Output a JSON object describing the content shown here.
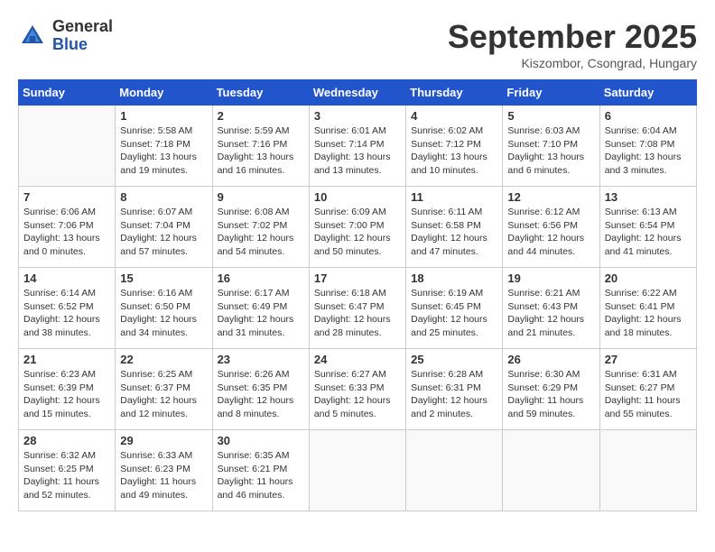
{
  "header": {
    "logo_general": "General",
    "logo_blue": "Blue",
    "month_title": "September 2025",
    "location": "Kiszombor, Csongrad, Hungary"
  },
  "days_of_week": [
    "Sunday",
    "Monday",
    "Tuesday",
    "Wednesday",
    "Thursday",
    "Friday",
    "Saturday"
  ],
  "weeks": [
    [
      {
        "day": "",
        "empty": true
      },
      {
        "day": "1",
        "sunrise": "Sunrise: 5:58 AM",
        "sunset": "Sunset: 7:18 PM",
        "daylight": "Daylight: 13 hours and 19 minutes."
      },
      {
        "day": "2",
        "sunrise": "Sunrise: 5:59 AM",
        "sunset": "Sunset: 7:16 PM",
        "daylight": "Daylight: 13 hours and 16 minutes."
      },
      {
        "day": "3",
        "sunrise": "Sunrise: 6:01 AM",
        "sunset": "Sunset: 7:14 PM",
        "daylight": "Daylight: 13 hours and 13 minutes."
      },
      {
        "day": "4",
        "sunrise": "Sunrise: 6:02 AM",
        "sunset": "Sunset: 7:12 PM",
        "daylight": "Daylight: 13 hours and 10 minutes."
      },
      {
        "day": "5",
        "sunrise": "Sunrise: 6:03 AM",
        "sunset": "Sunset: 7:10 PM",
        "daylight": "Daylight: 13 hours and 6 minutes."
      },
      {
        "day": "6",
        "sunrise": "Sunrise: 6:04 AM",
        "sunset": "Sunset: 7:08 PM",
        "daylight": "Daylight: 13 hours and 3 minutes."
      }
    ],
    [
      {
        "day": "7",
        "sunrise": "Sunrise: 6:06 AM",
        "sunset": "Sunset: 7:06 PM",
        "daylight": "Daylight: 13 hours and 0 minutes."
      },
      {
        "day": "8",
        "sunrise": "Sunrise: 6:07 AM",
        "sunset": "Sunset: 7:04 PM",
        "daylight": "Daylight: 12 hours and 57 minutes."
      },
      {
        "day": "9",
        "sunrise": "Sunrise: 6:08 AM",
        "sunset": "Sunset: 7:02 PM",
        "daylight": "Daylight: 12 hours and 54 minutes."
      },
      {
        "day": "10",
        "sunrise": "Sunrise: 6:09 AM",
        "sunset": "Sunset: 7:00 PM",
        "daylight": "Daylight: 12 hours and 50 minutes."
      },
      {
        "day": "11",
        "sunrise": "Sunrise: 6:11 AM",
        "sunset": "Sunset: 6:58 PM",
        "daylight": "Daylight: 12 hours and 47 minutes."
      },
      {
        "day": "12",
        "sunrise": "Sunrise: 6:12 AM",
        "sunset": "Sunset: 6:56 PM",
        "daylight": "Daylight: 12 hours and 44 minutes."
      },
      {
        "day": "13",
        "sunrise": "Sunrise: 6:13 AM",
        "sunset": "Sunset: 6:54 PM",
        "daylight": "Daylight: 12 hours and 41 minutes."
      }
    ],
    [
      {
        "day": "14",
        "sunrise": "Sunrise: 6:14 AM",
        "sunset": "Sunset: 6:52 PM",
        "daylight": "Daylight: 12 hours and 38 minutes."
      },
      {
        "day": "15",
        "sunrise": "Sunrise: 6:16 AM",
        "sunset": "Sunset: 6:50 PM",
        "daylight": "Daylight: 12 hours and 34 minutes."
      },
      {
        "day": "16",
        "sunrise": "Sunrise: 6:17 AM",
        "sunset": "Sunset: 6:49 PM",
        "daylight": "Daylight: 12 hours and 31 minutes."
      },
      {
        "day": "17",
        "sunrise": "Sunrise: 6:18 AM",
        "sunset": "Sunset: 6:47 PM",
        "daylight": "Daylight: 12 hours and 28 minutes."
      },
      {
        "day": "18",
        "sunrise": "Sunrise: 6:19 AM",
        "sunset": "Sunset: 6:45 PM",
        "daylight": "Daylight: 12 hours and 25 minutes."
      },
      {
        "day": "19",
        "sunrise": "Sunrise: 6:21 AM",
        "sunset": "Sunset: 6:43 PM",
        "daylight": "Daylight: 12 hours and 21 minutes."
      },
      {
        "day": "20",
        "sunrise": "Sunrise: 6:22 AM",
        "sunset": "Sunset: 6:41 PM",
        "daylight": "Daylight: 12 hours and 18 minutes."
      }
    ],
    [
      {
        "day": "21",
        "sunrise": "Sunrise: 6:23 AM",
        "sunset": "Sunset: 6:39 PM",
        "daylight": "Daylight: 12 hours and 15 minutes."
      },
      {
        "day": "22",
        "sunrise": "Sunrise: 6:25 AM",
        "sunset": "Sunset: 6:37 PM",
        "daylight": "Daylight: 12 hours and 12 minutes."
      },
      {
        "day": "23",
        "sunrise": "Sunrise: 6:26 AM",
        "sunset": "Sunset: 6:35 PM",
        "daylight": "Daylight: 12 hours and 8 minutes."
      },
      {
        "day": "24",
        "sunrise": "Sunrise: 6:27 AM",
        "sunset": "Sunset: 6:33 PM",
        "daylight": "Daylight: 12 hours and 5 minutes."
      },
      {
        "day": "25",
        "sunrise": "Sunrise: 6:28 AM",
        "sunset": "Sunset: 6:31 PM",
        "daylight": "Daylight: 12 hours and 2 minutes."
      },
      {
        "day": "26",
        "sunrise": "Sunrise: 6:30 AM",
        "sunset": "Sunset: 6:29 PM",
        "daylight": "Daylight: 11 hours and 59 minutes."
      },
      {
        "day": "27",
        "sunrise": "Sunrise: 6:31 AM",
        "sunset": "Sunset: 6:27 PM",
        "daylight": "Daylight: 11 hours and 55 minutes."
      }
    ],
    [
      {
        "day": "28",
        "sunrise": "Sunrise: 6:32 AM",
        "sunset": "Sunset: 6:25 PM",
        "daylight": "Daylight: 11 hours and 52 minutes."
      },
      {
        "day": "29",
        "sunrise": "Sunrise: 6:33 AM",
        "sunset": "Sunset: 6:23 PM",
        "daylight": "Daylight: 11 hours and 49 minutes."
      },
      {
        "day": "30",
        "sunrise": "Sunrise: 6:35 AM",
        "sunset": "Sunset: 6:21 PM",
        "daylight": "Daylight: 11 hours and 46 minutes."
      },
      {
        "day": "",
        "empty": true
      },
      {
        "day": "",
        "empty": true
      },
      {
        "day": "",
        "empty": true
      },
      {
        "day": "",
        "empty": true
      }
    ]
  ]
}
